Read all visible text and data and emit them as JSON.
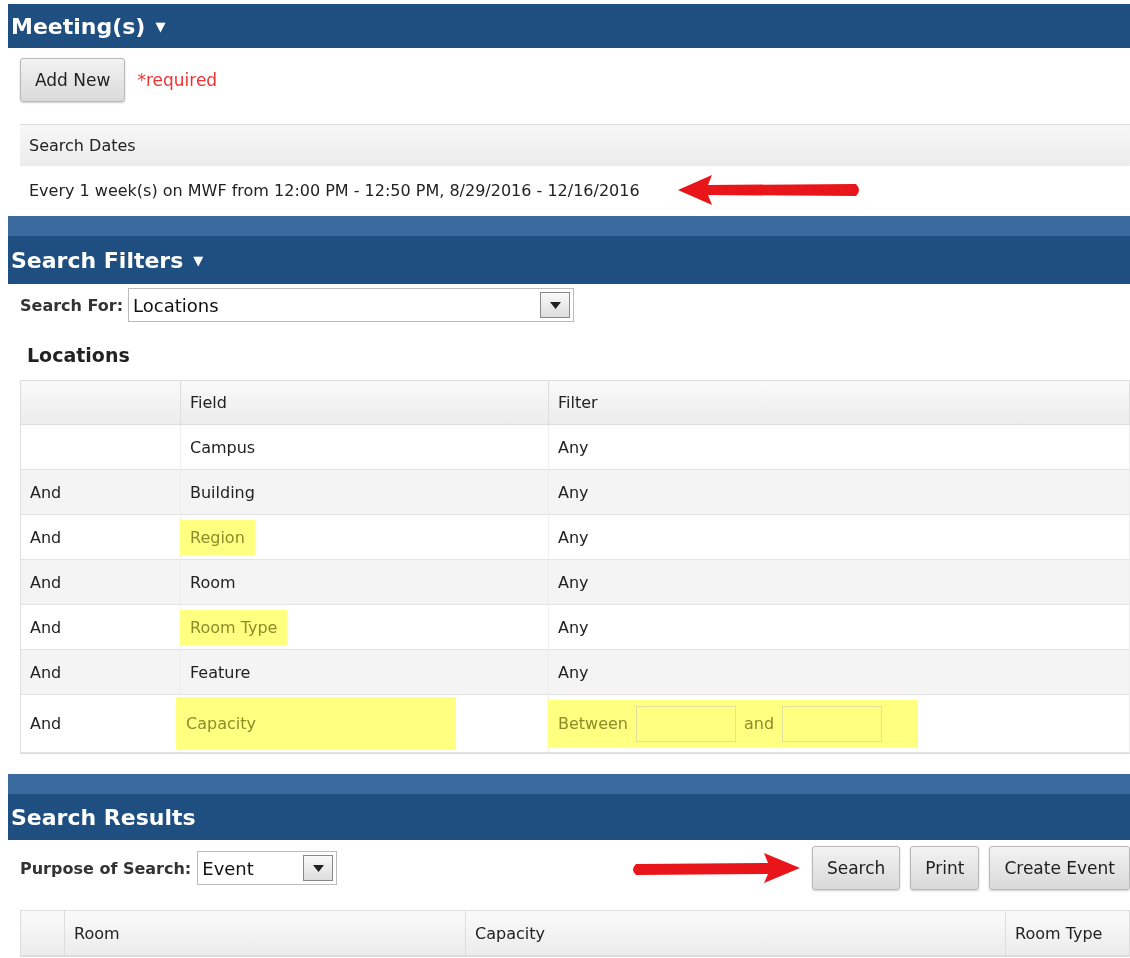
{
  "meetings": {
    "title": "Meeting(s)",
    "toggle": "▼",
    "add_button": "Add New",
    "required_note": "*required",
    "dates_header": "Search Dates",
    "dates": [
      "Every 1 week(s) on MWF from 12:00 PM - 12:50 PM, 8/29/2016 - 12/16/2016"
    ],
    "pointer": {
      "kind": "arrow_left"
    }
  },
  "search_filters": {
    "title": "Search Filters",
    "toggle": "▼",
    "search_for_label": "Search For:",
    "search_for_value": "Locations",
    "section_title": "Locations",
    "columns": {
      "field": "Field",
      "filter": "Filter"
    },
    "rows": [
      {
        "kind": "text",
        "field": "Campus",
        "filter": "Any",
        "highlighted": false
      },
      {
        "kind": "text",
        "conjunction": "And",
        "field": "Building",
        "filter": "Any",
        "highlighted": false
      },
      {
        "kind": "text",
        "conjunction": "And",
        "field": "Region",
        "filter": "Any",
        "highlighted": true
      },
      {
        "kind": "text",
        "conjunction": "And",
        "field": "Room",
        "filter": "Any",
        "highlighted": false
      },
      {
        "kind": "text",
        "conjunction": "And",
        "field": "Room Type",
        "filter": "Any",
        "highlighted": true
      },
      {
        "kind": "text",
        "conjunction": "And",
        "field": "Feature",
        "filter": "Any",
        "highlighted": false
      },
      {
        "kind": "range",
        "conjunction": "And",
        "field": "Capacity",
        "filter_label": "Between",
        "joiner": "and",
        "highlighted": true
      }
    ]
  },
  "search_results": {
    "title": "Search Results",
    "purpose_label": "Purpose of Search:",
    "purpose_value": "Event",
    "pointer": {
      "kind": "arrow_right"
    },
    "buttons": [
      "Search",
      "Print",
      "Create Event"
    ],
    "columns": [
      "Room",
      "Capacity",
      "Room Type"
    ]
  }
}
